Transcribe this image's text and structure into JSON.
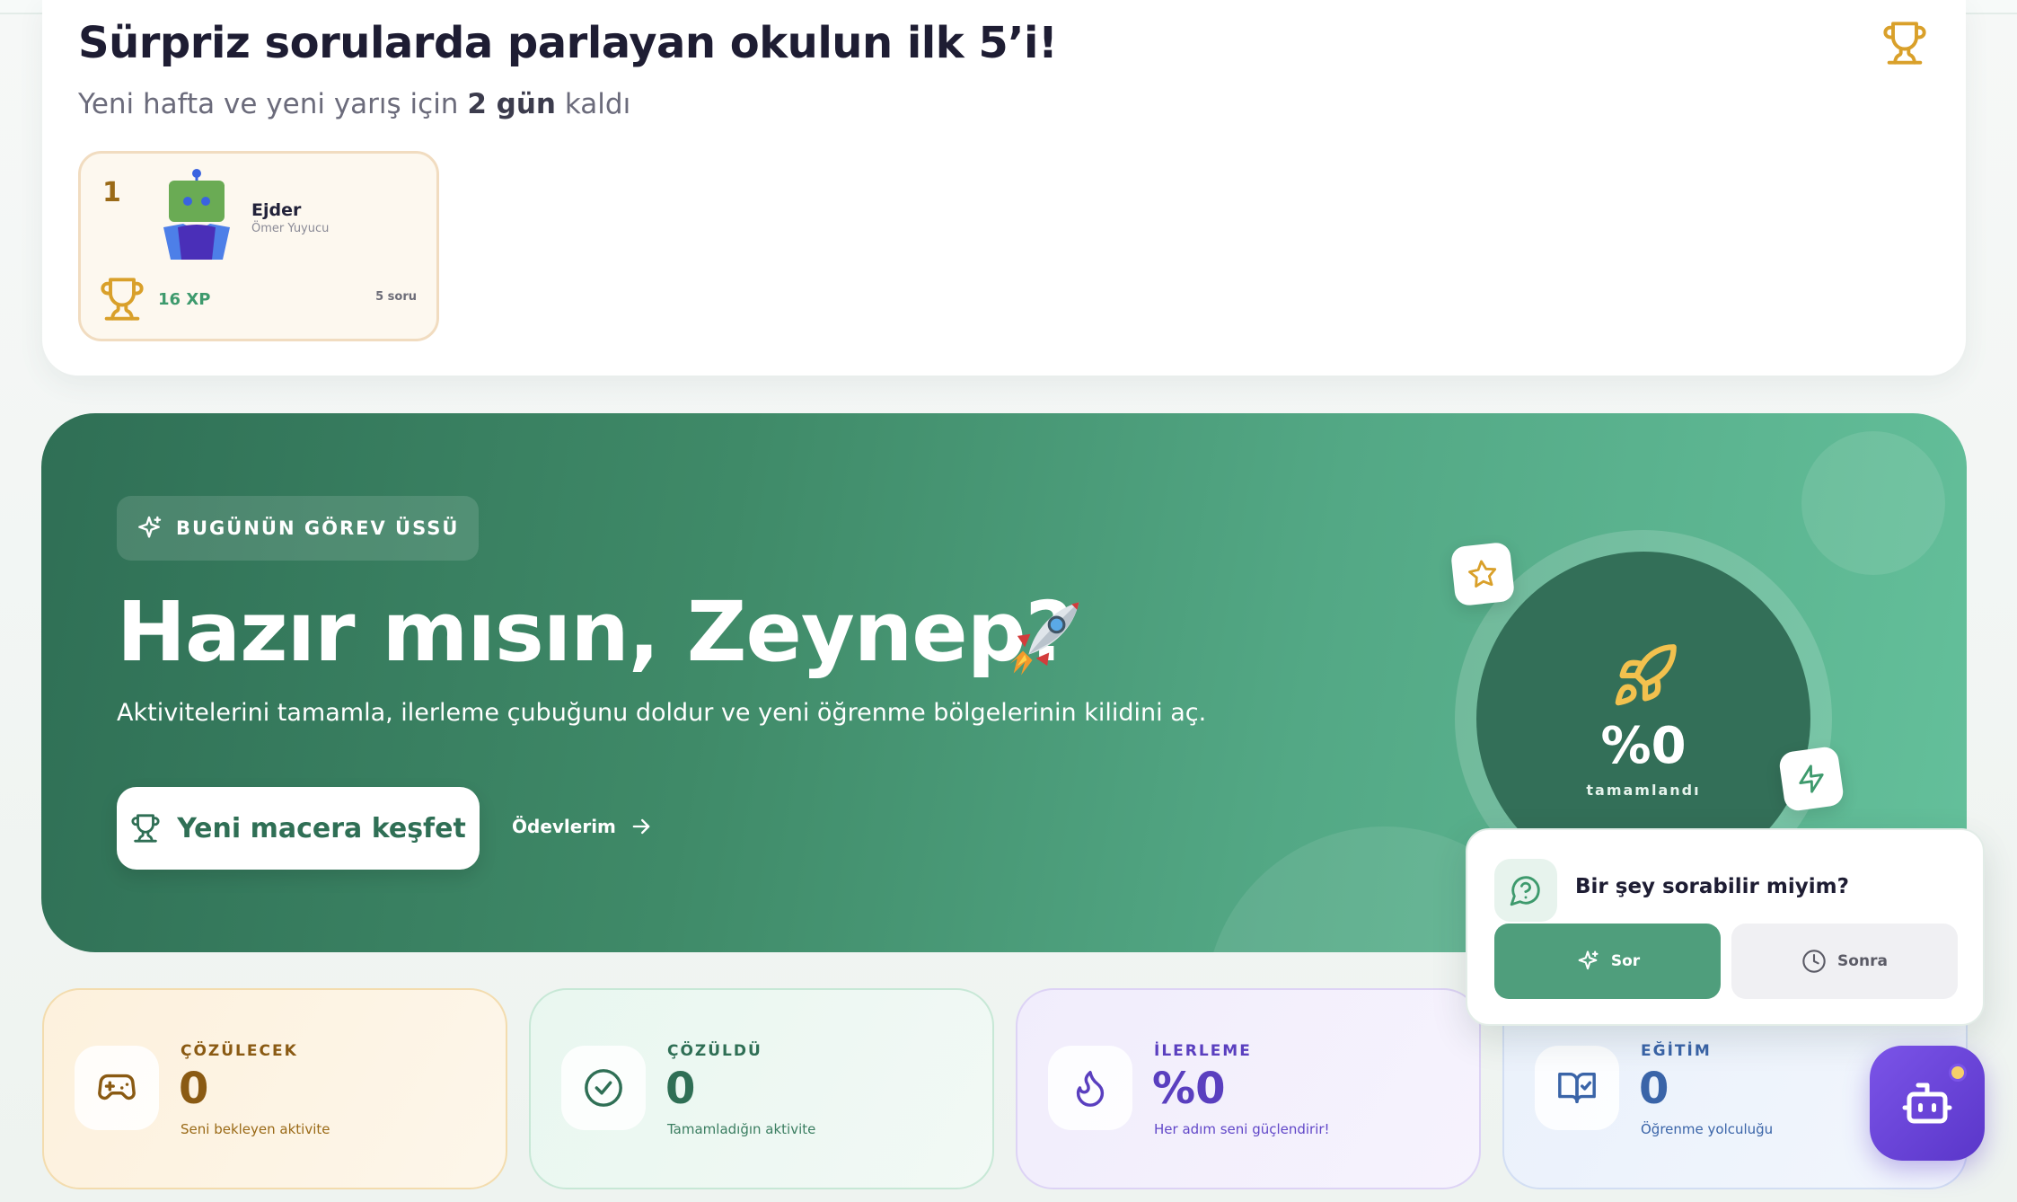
{
  "leaderboard": {
    "title": "Sürpriz sorularda parlayan okulun ilk 5’i!",
    "subtitle_prefix": "Yeni hafta ve yeni yarış için",
    "subtitle_days": "2 gün",
    "subtitle_suffix": "kaldı",
    "entries": [
      {
        "rank": "1",
        "name": "Ejder",
        "student": "Ömer Yuyucu",
        "xp": "16 XP",
        "questions": "5 soru"
      }
    ]
  },
  "hero": {
    "badge": "BUGÜNÜN GÖREV ÜSSÜ",
    "title": "Hazır mısın, Zeynep?",
    "emoji": "rocket",
    "description": "Aktivitelerini tamamla, ilerleme çubuğunu doldur ve yeni öğrenme bölgelerinin kilidini aç.",
    "cta_label": "Yeni macera keşfet",
    "link_label": "Ödevlerim",
    "progress_percent": 0,
    "progress_value": "%0",
    "progress_label": "tamamlandı"
  },
  "stats": [
    {
      "label": "ÇÖZÜLECEK",
      "value": "0",
      "desc": "Seni bekleyen aktivite",
      "icon": "gamepad-icon"
    },
    {
      "label": "ÇÖZÜLDÜ",
      "value": "0",
      "desc": "Tamamladığın aktivite",
      "icon": "check-circle-icon"
    },
    {
      "label": "İLERLEME",
      "value": "%0",
      "desc": "Her adım seni güçlendirir!",
      "icon": "flame-icon"
    },
    {
      "label": "EĞİTİM",
      "value": "0",
      "desc": "Öğrenme yolculuğu",
      "icon": "book-check-icon"
    }
  ],
  "ask_popup": {
    "title": "Bir şey sorabilir miyim?",
    "yes_label": "Sor",
    "later_label": "Sonra"
  },
  "colors": {
    "brand_green": "#2f6f55",
    "accent_green": "#4f9e7c",
    "gold": "#d9a02a",
    "purple": "#6a45d8"
  }
}
